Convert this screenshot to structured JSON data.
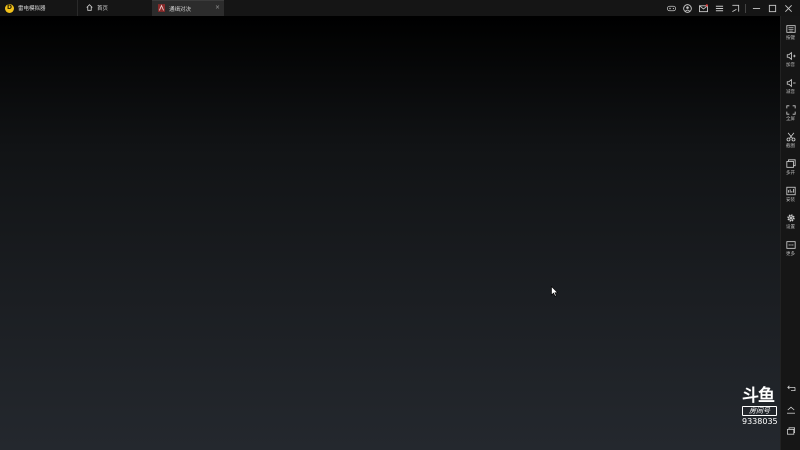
{
  "titlebar": {
    "app_name": "雷电模拟器",
    "logo_letter": "D",
    "tabs": [
      {
        "label": "首页",
        "icon": "home-icon"
      },
      {
        "label": "通缉对决",
        "icon": "game-icon"
      }
    ],
    "controls": [
      "gamepad-icon",
      "user-icon",
      "mail-icon",
      "menu-icon",
      "back-pin-icon",
      "minimize-icon",
      "maximize-icon",
      "close-icon"
    ]
  },
  "sidebar": {
    "items": [
      {
        "label": "按键",
        "icon": "keyboard-icon"
      },
      {
        "label": "加音",
        "icon": "volume-up-icon"
      },
      {
        "label": "减音",
        "icon": "volume-down-icon"
      },
      {
        "label": "全屏",
        "icon": "fullscreen-icon"
      },
      {
        "label": "截图",
        "icon": "scissors-icon"
      },
      {
        "label": "多开",
        "icon": "multi-instance-icon"
      },
      {
        "label": "安装",
        "icon": "install-icon"
      },
      {
        "label": "设置",
        "icon": "gear-icon"
      },
      {
        "label": "更多",
        "icon": "more-icon"
      }
    ],
    "nav": [
      "back-icon",
      "home-icon",
      "recent-apps-icon"
    ]
  },
  "watermark": {
    "brand": "斗鱼",
    "subtitle": "房间号",
    "room_number": "9338035"
  },
  "colors": {
    "logo": "#f2c21b",
    "titlebar_bg": "#151515",
    "active_tab_bg": "#2c2c2c",
    "sidebar_bg": "#161616"
  }
}
